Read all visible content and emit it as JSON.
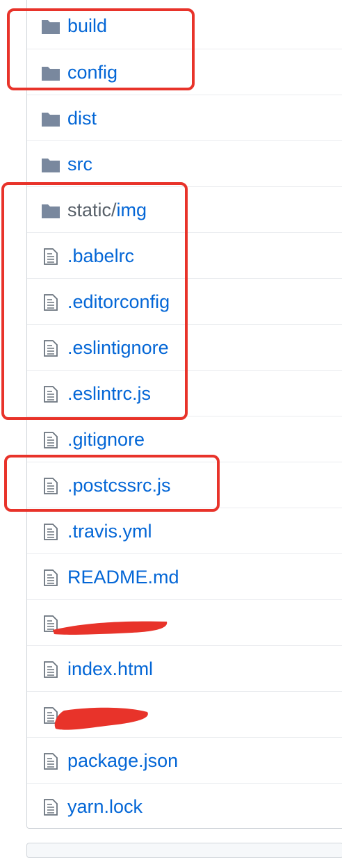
{
  "files": [
    {
      "name": "build",
      "type": "dir",
      "icon": "folder-icon"
    },
    {
      "name": "config",
      "type": "dir",
      "icon": "folder-icon"
    },
    {
      "name": "dist",
      "type": "dir",
      "icon": "folder-icon"
    },
    {
      "name": "src",
      "type": "dir",
      "icon": "folder-icon"
    },
    {
      "name_prefix": "static/",
      "name": "img",
      "type": "dir",
      "icon": "folder-icon"
    },
    {
      "name": ".babelrc",
      "type": "file",
      "icon": "file-icon"
    },
    {
      "name": ".editorconfig",
      "type": "file",
      "icon": "file-icon"
    },
    {
      "name": ".eslintignore",
      "type": "file",
      "icon": "file-icon"
    },
    {
      "name": ".eslintrc.js",
      "type": "file",
      "icon": "file-icon"
    },
    {
      "name": ".gitignore",
      "type": "file",
      "icon": "file-icon"
    },
    {
      "name": ".postcssrc.js",
      "type": "file",
      "icon": "file-icon"
    },
    {
      "name": ".travis.yml",
      "type": "file",
      "icon": "file-icon"
    },
    {
      "name": "README.md",
      "type": "file",
      "icon": "file-icon"
    },
    {
      "name": "",
      "type": "file",
      "icon": "file-icon",
      "redacted": true
    },
    {
      "name": "index.html",
      "type": "file",
      "icon": "file-icon"
    },
    {
      "name": "",
      "type": "file",
      "icon": "file-icon",
      "redacted": true
    },
    {
      "name": "package.json",
      "type": "file",
      "icon": "file-icon"
    },
    {
      "name": "yarn.lock",
      "type": "file",
      "icon": "file-icon"
    }
  ],
  "colors": {
    "link": "#0366d6",
    "prefix": "#586069",
    "folder_icon": "#79889e",
    "file_icon": "#6a737d",
    "highlight": "#e8332a",
    "border": "#d1d5da"
  }
}
